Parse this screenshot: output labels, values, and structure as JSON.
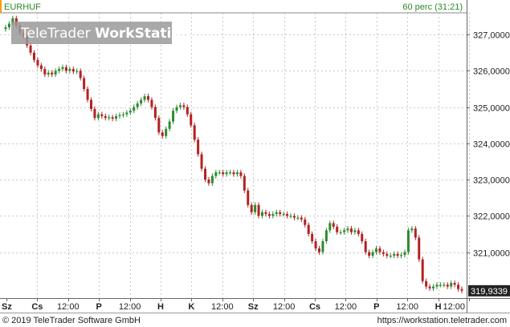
{
  "header": {
    "symbol": "EURHUF",
    "interval": "60 perc (31:21)"
  },
  "watermark": {
    "brand": "TeleTrader",
    "product": "WorkStation"
  },
  "footer": {
    "copyright": "© 2019 TeleTrader Software GmbH",
    "url": "https://workstation.teletrader.com"
  },
  "colors": {
    "up": "#2e8b2e",
    "down": "#b22222",
    "grid": "#c8c8c8",
    "header_text": "#2a8a2a",
    "label_bg": "#222222"
  },
  "chart_data": {
    "type": "candlestick",
    "title": "EURHUF",
    "interval": "60 perc",
    "ylim": [
      319.73,
      327.6
    ],
    "y_ticks": [
      321,
      322,
      323,
      324,
      325,
      326,
      327
    ],
    "y_tick_labels": [
      "321,0000",
      "322,0000",
      "323,0000",
      "324,0000",
      "325,0000",
      "326,0000",
      "327,0000"
    ],
    "x_tick_labels": [
      "Sz",
      "Cs",
      "12:00",
      "P",
      "12:00",
      "H",
      "K",
      "12:00",
      "Sz",
      "12:00",
      "Cs",
      "12:00",
      "P",
      "12:00",
      "H",
      "12:00"
    ],
    "x_bold_labels": [
      "Sz",
      "Cs",
      "P",
      "H",
      "K"
    ],
    "last_value": 319.9339,
    "last_value_label": "319,9339",
    "grid": true,
    "series": [
      {
        "values": [
          327.2,
          327.3,
          327.45,
          327.25,
          327.05,
          326.95,
          326.7,
          326.5,
          326.3,
          326.15,
          326.05,
          325.9,
          325.95,
          325.9,
          326.0,
          326.05,
          326.1,
          326.0,
          326.05,
          325.98,
          326.0,
          325.8,
          325.5,
          325.2,
          324.95,
          324.7,
          324.8,
          324.75,
          324.7,
          324.72,
          324.68,
          324.75,
          324.78,
          324.8,
          324.85,
          324.9,
          325.0,
          325.1,
          325.2,
          325.3,
          325.2,
          325.0,
          324.7,
          324.3,
          324.2,
          324.4,
          324.6,
          324.9,
          325.0,
          325.05,
          325.0,
          324.8,
          324.5,
          324.1,
          323.7,
          323.3,
          323.0,
          322.9,
          323.1,
          323.2,
          323.2,
          323.15,
          323.2,
          323.2,
          323.15,
          323.2,
          323.1,
          322.7,
          322.3,
          322.1,
          322.3,
          322.0,
          322.1,
          322.05,
          322.0,
          322.05,
          322.1,
          322.05,
          322.05,
          322.0,
          322.0,
          321.95,
          321.95,
          321.9,
          321.75,
          321.5,
          321.3,
          321.1,
          321.0,
          321.3,
          321.6,
          321.8,
          321.7,
          321.55,
          321.55,
          321.6,
          321.65,
          321.55,
          321.6,
          321.5,
          321.3,
          321.0,
          320.9,
          321.0,
          321.1,
          321.0,
          320.95,
          320.9,
          320.9,
          320.95,
          320.9,
          320.92,
          321.0,
          321.6,
          321.65,
          321.4,
          320.8,
          320.2,
          320.05,
          320.0,
          320.05,
          320.1,
          320.1,
          320.1,
          320.05,
          320.15,
          320.1,
          319.98,
          319.9339
        ]
      }
    ]
  }
}
